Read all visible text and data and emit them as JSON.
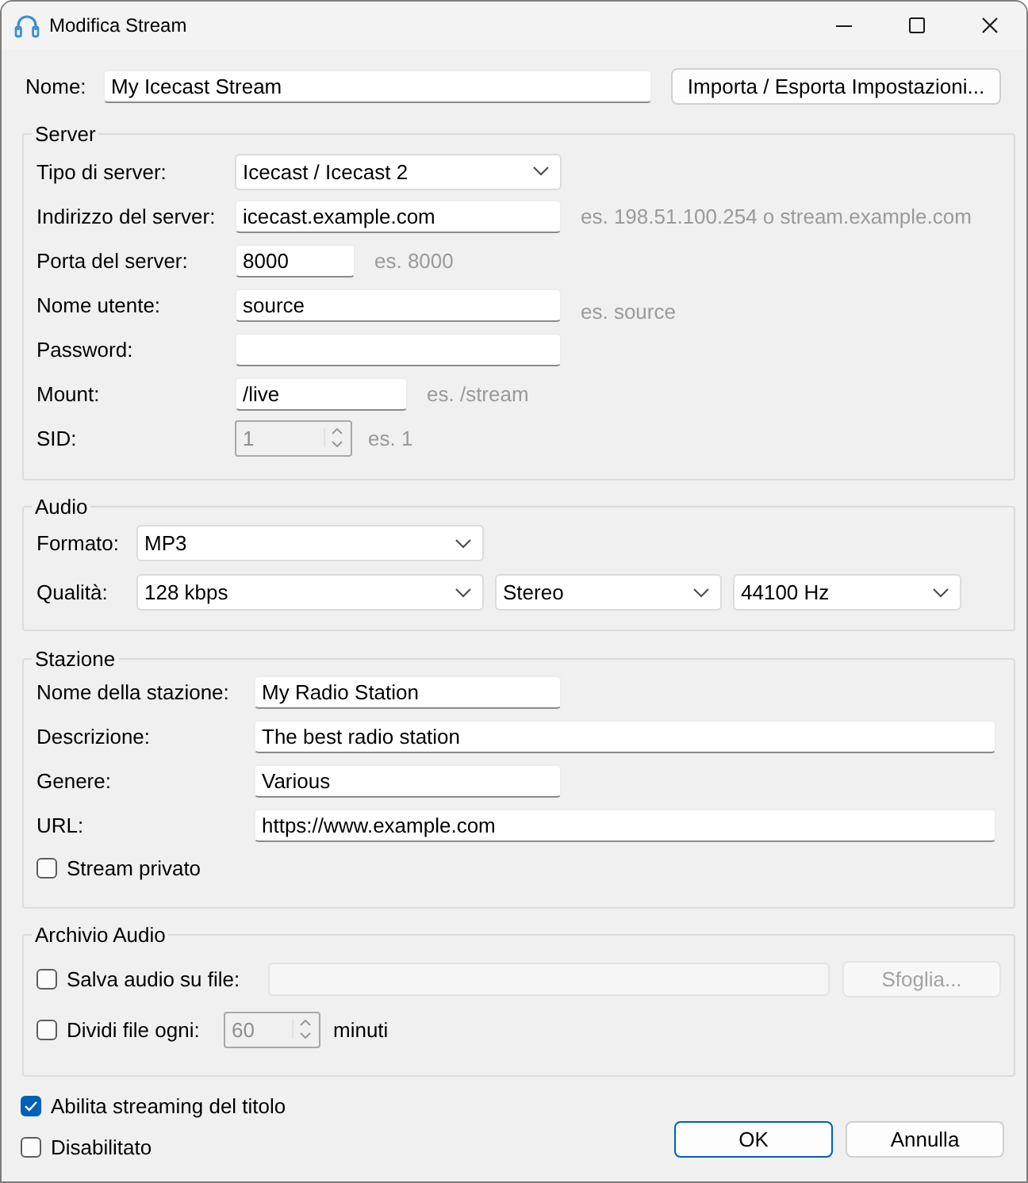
{
  "window": {
    "title": "Modifica Stream"
  },
  "name_row": {
    "label": "Nome:",
    "value": "My Icecast Stream",
    "button": "Importa / Esporta Impostazioni..."
  },
  "server": {
    "title": "Server",
    "fields": [
      {
        "kind": "select",
        "label": "Tipo di server:",
        "value": "Icecast / Icecast 2",
        "disabled": false
      },
      {
        "kind": "text",
        "label": "Indirizzo del server:",
        "value": "icecast.example.com",
        "hint": "es. 198.51.100.254 o stream.example.com",
        "disabled": false
      },
      {
        "kind": "text",
        "label": "Porta del server:",
        "value": "8000",
        "hint": "es. 8000",
        "disabled": false
      },
      {
        "kind": "text",
        "label": "Nome utente:",
        "value": "source",
        "hint": "es. source",
        "disabled": false
      },
      {
        "kind": "text",
        "label": "Password:",
        "disabled": false
      },
      {
        "kind": "text",
        "label": "Mount:",
        "value": "/live",
        "hint": "es. /stream",
        "disabled": false
      },
      {
        "kind": "spin",
        "label": "SID:",
        "value": "1",
        "hint": "es. 1",
        "disabled": true
      }
    ]
  },
  "audio": {
    "title": "Audio",
    "rows": [
      {
        "label": "Formato:",
        "dropdowns": [
          "MP3"
        ]
      },
      {
        "label": "Qualità:",
        "dropdowns": [
          "128 kbps",
          "Stereo",
          "44100 Hz"
        ]
      }
    ]
  },
  "station": {
    "title": "Stazione",
    "fields": [
      {
        "label": "Nome della stazione:",
        "value": "My Radio Station"
      },
      {
        "label": "Descrizione:",
        "value": "The best radio station"
      },
      {
        "label": "Genere:",
        "value": "Various"
      },
      {
        "label": "URL:",
        "value": "https://www.example.com"
      }
    ],
    "private": {
      "label": "Stream privato",
      "checked": false
    }
  },
  "archive": {
    "title": "Archivio Audio",
    "save": {
      "label": "Salva audio su file:",
      "checked": false,
      "path_disabled": true,
      "browse": {
        "label": "Sfoglia...",
        "disabled": true
      }
    },
    "split": {
      "label": "Dividi file ogni:",
      "checked": false,
      "value": "60",
      "disabled": true,
      "unit": "minuti"
    }
  },
  "options": [
    {
      "label": "Abilita streaming del titolo",
      "checked": true
    },
    {
      "label": "Disabilitato",
      "checked": false
    }
  ],
  "buttons": [
    {
      "label": "OK",
      "default": true
    },
    {
      "label": "Annulla",
      "default": false
    }
  ]
}
